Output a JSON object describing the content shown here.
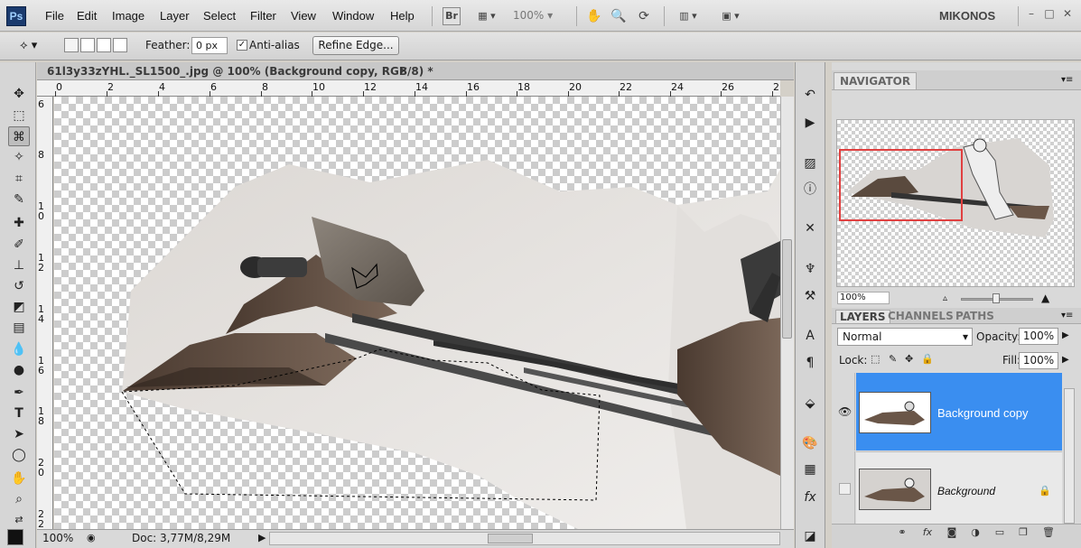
{
  "menubar": {
    "logo": "Ps",
    "items": [
      "File",
      "Edit",
      "Image",
      "Layer",
      "Select",
      "Filter",
      "View",
      "Window",
      "Help"
    ],
    "bridge_label": "Br",
    "zoom_value": "100%",
    "workspace": "MIKONOS"
  },
  "options": {
    "feather_label": "Feather:",
    "feather_value": "0 px",
    "antialias_label": "Anti-alias",
    "antialias_checked": true,
    "refine_edge_label": "Refine Edge..."
  },
  "document": {
    "tab_title": "61l3y33zYHL._SL1500_.jpg @ 100% (Background copy, RGB/8) *",
    "close_glyph": "×",
    "ruler_top": [
      "0",
      "2",
      "4",
      "6",
      "8",
      "10",
      "12",
      "14",
      "16",
      "18",
      "20",
      "22",
      "24",
      "26",
      "2"
    ],
    "ruler_left": [
      [
        "6"
      ],
      [
        "8"
      ],
      [
        "1",
        "0"
      ],
      [
        "1",
        "2"
      ],
      [
        "1",
        "4"
      ],
      [
        "1",
        "6"
      ],
      [
        "1",
        "8"
      ],
      [
        "2",
        "0"
      ],
      [
        "2",
        "2"
      ]
    ]
  },
  "status": {
    "zoom": "100%",
    "doc_info": "Doc: 3,77M/8,29M"
  },
  "navigator": {
    "tab_label": "NAVIGATOR",
    "zoom_value": "100%"
  },
  "layers": {
    "tabs": [
      "LAYERS",
      "CHANNELS",
      "PATHS"
    ],
    "blend_mode": "Normal",
    "opacity_label": "Opacity:",
    "opacity_value": "100%",
    "lock_label": "Lock:",
    "fill_label": "Fill:",
    "fill_value": "100%",
    "items": [
      {
        "name": "Background copy",
        "visible": true,
        "selected": true
      },
      {
        "name": "Background",
        "visible": false,
        "locked": true
      }
    ],
    "footer_fx": "fx"
  }
}
